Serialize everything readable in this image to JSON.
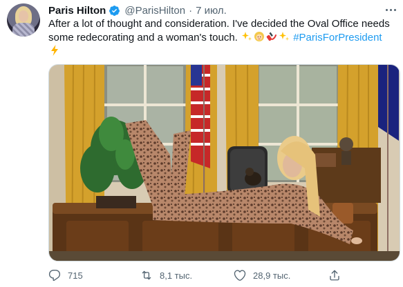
{
  "tweet": {
    "author_name": "Paris Hilton",
    "author_handle": "@ParisHilton",
    "separator": "·",
    "date": "7 июл.",
    "text_main": "After a lot of thought and consideration. I've decided the Oval Office needs some redecorating and a woman's touch.",
    "hashtag": "#ParisForPresident",
    "emojis": [
      "sparkles-icon",
      "blonde-woman-icon",
      "nail-polish-icon",
      "sparkles-icon",
      "lightning-icon"
    ]
  },
  "actions": {
    "reply_count": "715",
    "retweet_count": "8,1 тыс.",
    "like_count": "28,9 тыс."
  },
  "colors": {
    "accent": "#1d9bf0",
    "secondary_text": "#536471",
    "verified": "#1d9bf0"
  }
}
